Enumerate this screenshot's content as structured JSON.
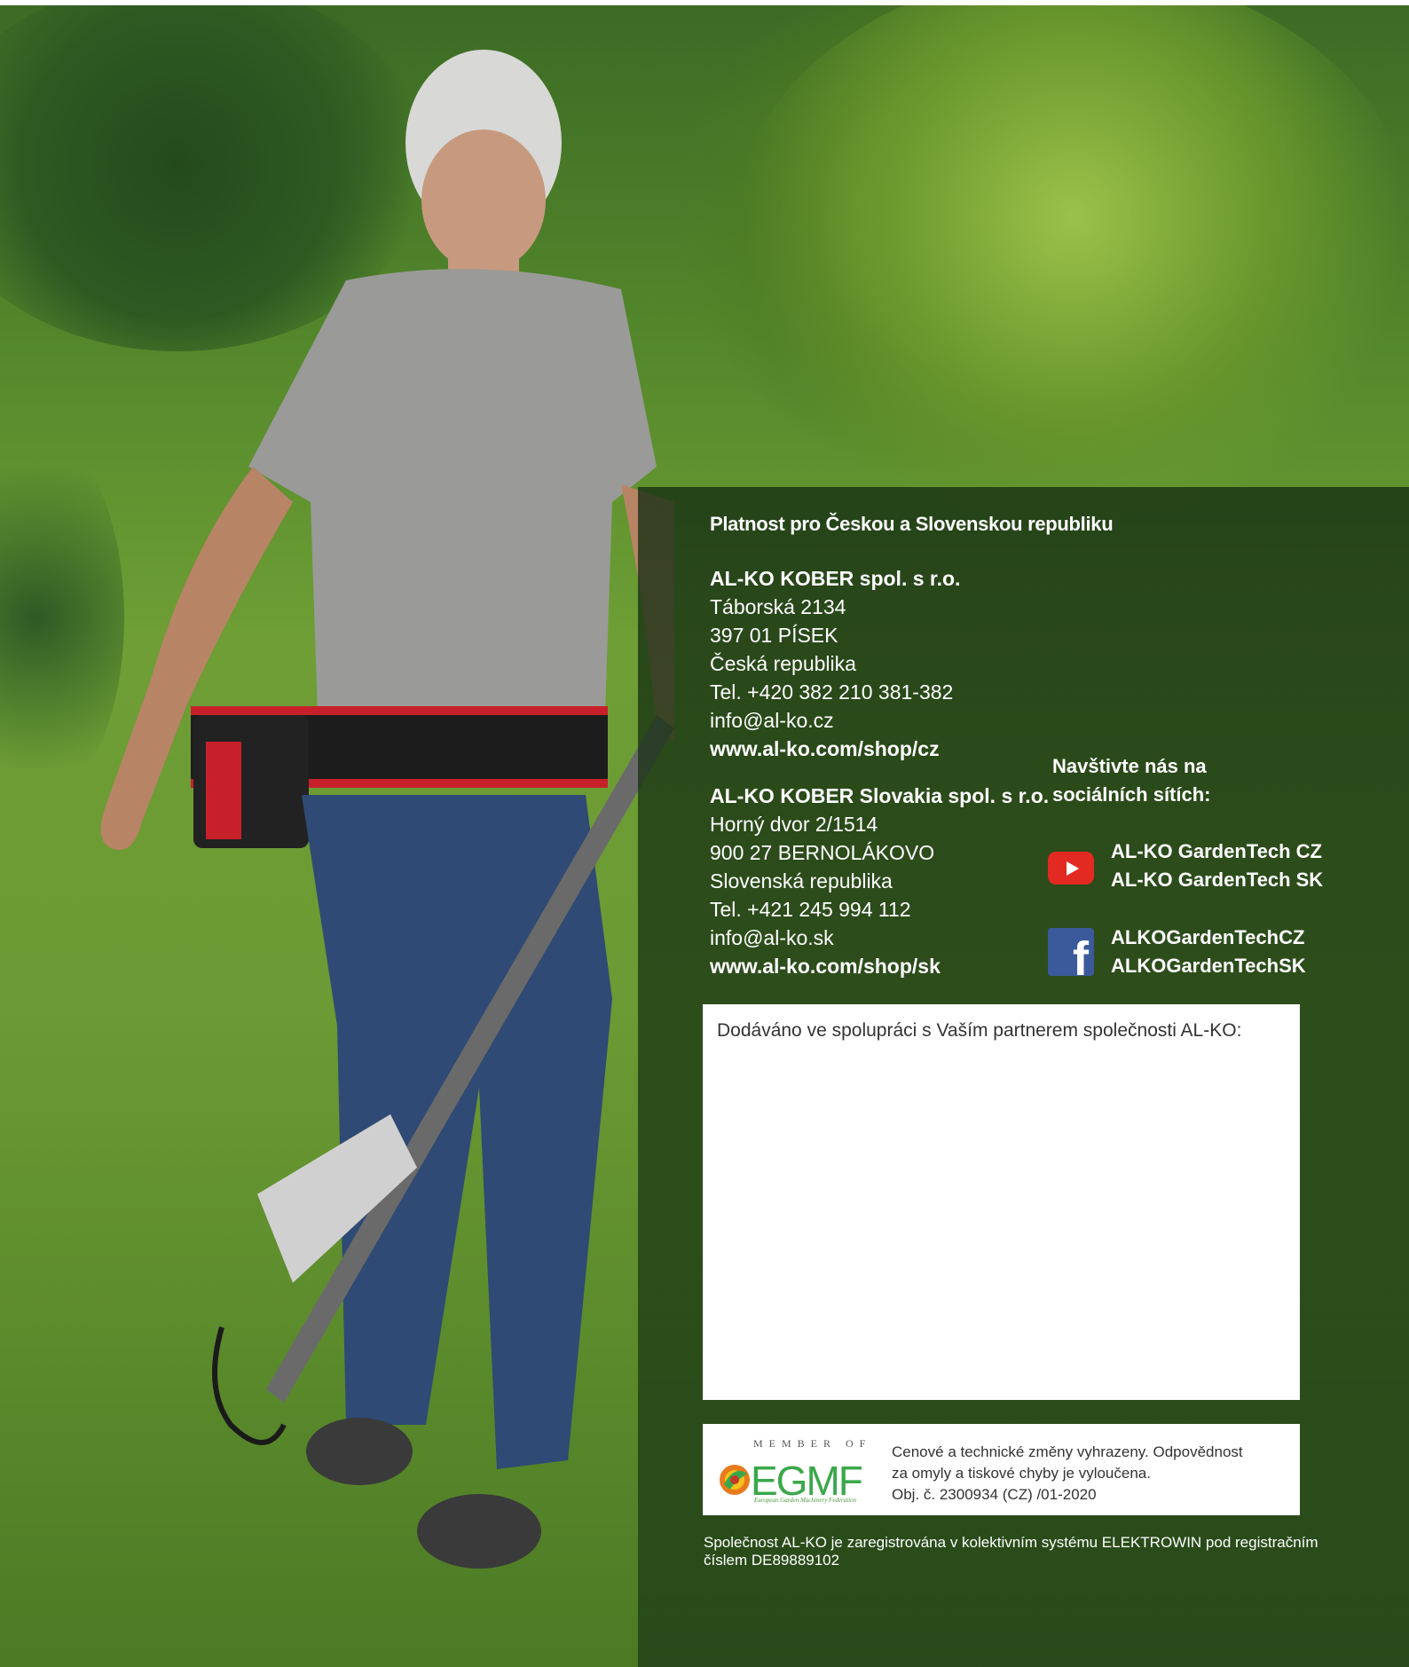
{
  "heading": "Platnost pro Českou a Slovenskou republiku",
  "contacts": [
    {
      "company": "AL-KO KOBER spol. s r.o.",
      "street": "Táborská 2134",
      "city": "397 01 PÍSEK",
      "country": "Česká republika",
      "phone": "Tel. +420 382 210 381-382",
      "email": "info@al-ko.cz",
      "web": "www.al-ko.com/shop/cz"
    },
    {
      "company": "AL-KO KOBER Slovakia spol. s r.o.",
      "street": "Horný dvor 2/1514",
      "city": "900 27 BERNOLÁKOVO",
      "country": "Slovenská republika",
      "phone": "Tel. +421 245 994 112",
      "email": "info@al-ko.sk",
      "web": "www.al-ko.com/shop/sk"
    }
  ],
  "social": {
    "heading_line1": "Navštivte nás na",
    "heading_line2": "sociálních sítích:",
    "youtube": [
      "AL-KO GardenTech CZ",
      "AL-KO GardenTech SK"
    ],
    "facebook": [
      "ALKOGardenTechCZ",
      "ALKOGardenTechSK"
    ],
    "youtube_icon": "youtube-icon",
    "facebook_icon": "facebook-icon",
    "youtube_color": "#e22a22",
    "facebook_color": "#3b5a9c"
  },
  "partner_box": {
    "label": "Dodáváno ve spolupráci s Vaším partnerem společnosti AL-KO:"
  },
  "egmf": {
    "member_of": "MEMBER OF",
    "logo_text": "EGMF",
    "logo_subtitle": "European Garden Machinery Federation",
    "disclaimer": [
      "Cenové a technické změny vyhrazeny. Odpovědnost",
      "za omyly a tiskové chyby je vyloučena.",
      "Obj. č. 2300934 (CZ) /01-2020"
    ],
    "logo_color": "#3aa84a"
  },
  "footer": [
    "Společnost AL-KO je zaregistrována v kolektivním systému ELEKTROWIN pod registračním",
    "číslem DE89889102"
  ]
}
